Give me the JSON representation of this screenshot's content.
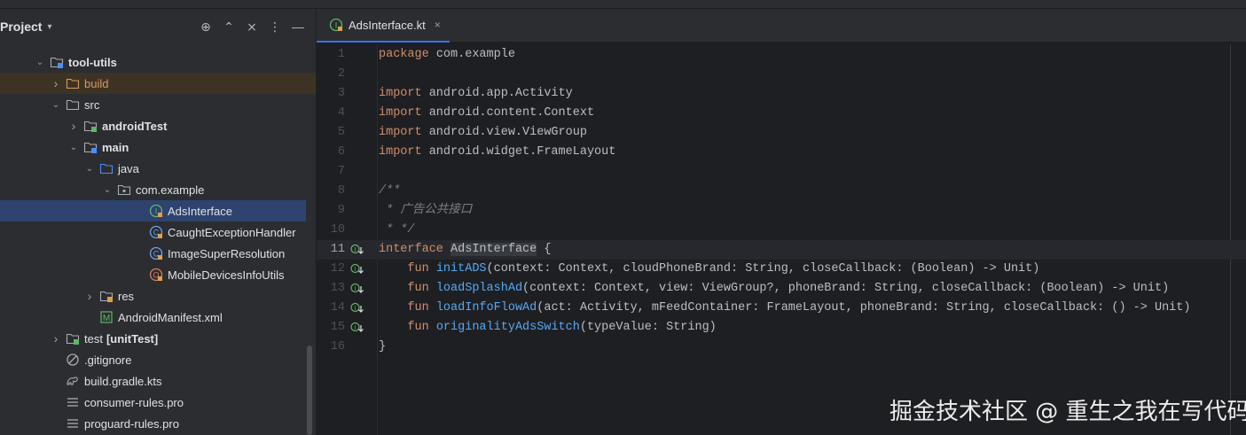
{
  "sidebar": {
    "title": "Project",
    "actions": [
      {
        "name": "locate-icon",
        "glyph": "⊕"
      },
      {
        "name": "expand-all-icon",
        "glyph": "⌃"
      },
      {
        "name": "collapse-all-icon",
        "glyph": "⨯"
      },
      {
        "name": "more-options-icon",
        "glyph": "⋮"
      },
      {
        "name": "hide-panel-icon",
        "glyph": "—"
      }
    ],
    "tree": [
      {
        "label": "tool-utils",
        "depth": 1,
        "arrow": "open",
        "icon": "module-folder",
        "style": "bold"
      },
      {
        "label": "build",
        "depth": 2,
        "arrow": "closed",
        "icon": "folder-orange",
        "style": "orange",
        "highlight": "build"
      },
      {
        "label": "src",
        "depth": 2,
        "arrow": "open",
        "icon": "folder",
        "style": ""
      },
      {
        "label": "androidTest",
        "depth": 3,
        "arrow": "closed",
        "icon": "folder-test",
        "style": "bold"
      },
      {
        "label": "main",
        "depth": 3,
        "arrow": "open",
        "icon": "folder-main",
        "style": "bold"
      },
      {
        "label": "java",
        "depth": 4,
        "arrow": "open",
        "icon": "folder-blue",
        "style": ""
      },
      {
        "label": "com.example",
        "depth": 5,
        "arrow": "open",
        "icon": "package",
        "style": ""
      },
      {
        "label": "AdsInterface",
        "depth": 6,
        "arrow": "none",
        "icon": "kotlin-interface",
        "style": "",
        "highlight": "selected"
      },
      {
        "label": "CaughtExceptionHandler",
        "depth": 6,
        "arrow": "none",
        "icon": "kotlin-class",
        "style": ""
      },
      {
        "label": "ImageSuperResolution",
        "depth": 6,
        "arrow": "none",
        "icon": "kotlin-class",
        "style": ""
      },
      {
        "label": "MobileDevicesInfoUtils",
        "depth": 6,
        "arrow": "none",
        "icon": "kotlin-object",
        "style": ""
      },
      {
        "label": "res",
        "depth": 4,
        "arrow": "closed",
        "icon": "folder-res",
        "style": ""
      },
      {
        "label": "AndroidManifest.xml",
        "depth": 4,
        "arrow": "none",
        "icon": "manifest",
        "style": ""
      },
      {
        "label": "test",
        "suffix": "[unitTest]",
        "depth": 2,
        "arrow": "closed",
        "icon": "folder-test",
        "style": ""
      },
      {
        "label": ".gitignore",
        "depth": 2,
        "arrow": "none",
        "icon": "gitignore",
        "style": ""
      },
      {
        "label": "build.gradle.kts",
        "depth": 2,
        "arrow": "none",
        "icon": "gradle",
        "style": ""
      },
      {
        "label": "consumer-rules.pro",
        "depth": 2,
        "arrow": "none",
        "icon": "text-file",
        "style": ""
      },
      {
        "label": "proguard-rules.pro",
        "depth": 2,
        "arrow": "none",
        "icon": "text-file",
        "style": ""
      }
    ]
  },
  "editor": {
    "tab": {
      "label": "AdsInterface.kt",
      "close": "×"
    },
    "current_line": 11,
    "lines": [
      {
        "n": "1",
        "tokens": [
          {
            "t": "package",
            "c": "kw"
          },
          {
            "t": " com.example",
            "c": ""
          }
        ]
      },
      {
        "n": "2",
        "tokens": []
      },
      {
        "n": "3",
        "tokens": [
          {
            "t": "import",
            "c": "kw"
          },
          {
            "t": " android.app.Activity",
            "c": ""
          }
        ]
      },
      {
        "n": "4",
        "tokens": [
          {
            "t": "import",
            "c": "kw"
          },
          {
            "t": " android.content.Context",
            "c": ""
          }
        ]
      },
      {
        "n": "5",
        "tokens": [
          {
            "t": "import",
            "c": "kw"
          },
          {
            "t": " android.view.ViewGroup",
            "c": ""
          }
        ]
      },
      {
        "n": "6",
        "tokens": [
          {
            "t": "import",
            "c": "kw"
          },
          {
            "t": " android.widget.FrameLayout",
            "c": ""
          }
        ]
      },
      {
        "n": "7",
        "tokens": []
      },
      {
        "n": "8",
        "tokens": [
          {
            "t": "/**",
            "c": "cm"
          }
        ]
      },
      {
        "n": "9",
        "tokens": [
          {
            "t": " * 广告公共接口",
            "c": "cm"
          }
        ]
      },
      {
        "n": "10",
        "tokens": [
          {
            "t": " * */",
            "c": "cm"
          }
        ]
      },
      {
        "n": "11",
        "gutter": true,
        "tokens": [
          {
            "t": "interface",
            "c": "kw"
          },
          {
            "t": " ",
            "c": ""
          },
          {
            "t": "AdsInterface",
            "c": "hl"
          },
          {
            "t": " {",
            "c": ""
          }
        ]
      },
      {
        "n": "12",
        "gutter": true,
        "tokens": [
          {
            "t": "    ",
            "c": ""
          },
          {
            "t": "fun",
            "c": "kw"
          },
          {
            "t": " ",
            "c": ""
          },
          {
            "t": "initADS",
            "c": "fn"
          },
          {
            "t": "(context: Context, cloudPhoneBrand: String, closeCallback: (Boolean) -> Unit)",
            "c": ""
          }
        ]
      },
      {
        "n": "13",
        "gutter": true,
        "tokens": [
          {
            "t": "    ",
            "c": ""
          },
          {
            "t": "fun",
            "c": "kw"
          },
          {
            "t": " ",
            "c": ""
          },
          {
            "t": "loadSplashAd",
            "c": "fn"
          },
          {
            "t": "(context: Context, view: ViewGroup?, phoneBrand: String, closeCallback: (Boolean) -> Unit)",
            "c": ""
          }
        ]
      },
      {
        "n": "14",
        "gutter": true,
        "tokens": [
          {
            "t": "    ",
            "c": ""
          },
          {
            "t": "fun",
            "c": "kw"
          },
          {
            "t": " ",
            "c": ""
          },
          {
            "t": "loadInfoFlowAd",
            "c": "fn"
          },
          {
            "t": "(act: Activity, mFeedContainer: FrameLayout, phoneBrand: String, closeCallback: () -> Unit)",
            "c": ""
          }
        ]
      },
      {
        "n": "15",
        "gutter": true,
        "tokens": [
          {
            "t": "    ",
            "c": ""
          },
          {
            "t": "fun",
            "c": "kw"
          },
          {
            "t": " ",
            "c": ""
          },
          {
            "t": "originalityAdsSwitch",
            "c": "fn"
          },
          {
            "t": "(typeValue: String)",
            "c": ""
          }
        ]
      },
      {
        "n": "16",
        "tokens": [
          {
            "t": "}",
            "c": ""
          }
        ]
      }
    ]
  },
  "watermark": "掘金技术社区 @ 重生之我在写代码",
  "colors": {
    "accent": "#3574f0",
    "keyword": "#cf8e6d",
    "function": "#56a8f5",
    "comment": "#7a7e85",
    "selection": "#2e436e"
  }
}
